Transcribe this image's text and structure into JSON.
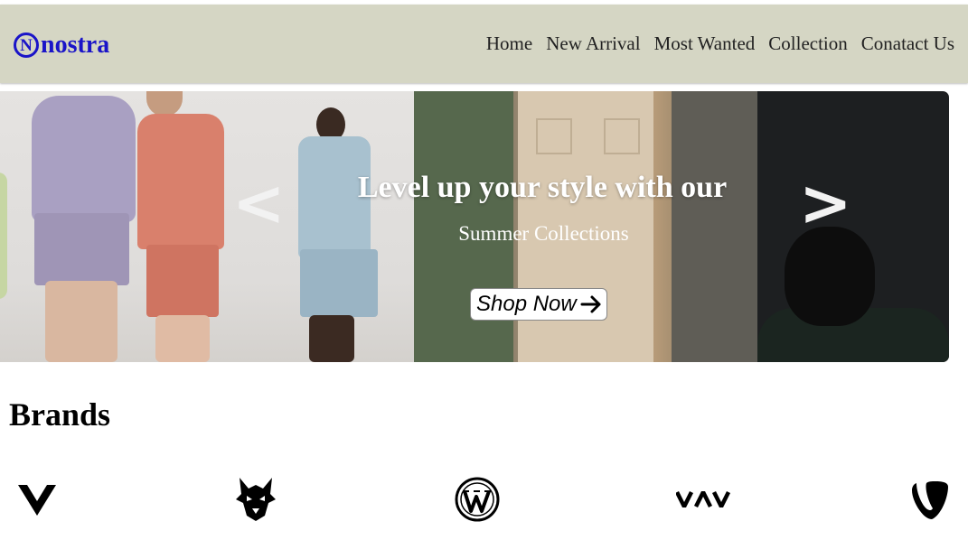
{
  "header": {
    "logo_mark": "N",
    "logo_text": "nostra",
    "nav": [
      "Home",
      "New Arrival",
      "Most Wanted",
      "Collection",
      "Conatact Us"
    ]
  },
  "hero": {
    "prev_arrow": "<",
    "next_arrow": ">",
    "title": "Level up your style with our",
    "subtitle": "Summer Collections",
    "cta_label": "Shop Now"
  },
  "brands": {
    "title": "Brands",
    "logos": [
      "v-brand-icon",
      "wolf-brand-icon",
      "wordpress-icon",
      "vav-brand-icon",
      "typo3-icon"
    ]
  },
  "colors": {
    "navbar_bg": "#d5d6c4",
    "logo": "#1a14c8"
  }
}
